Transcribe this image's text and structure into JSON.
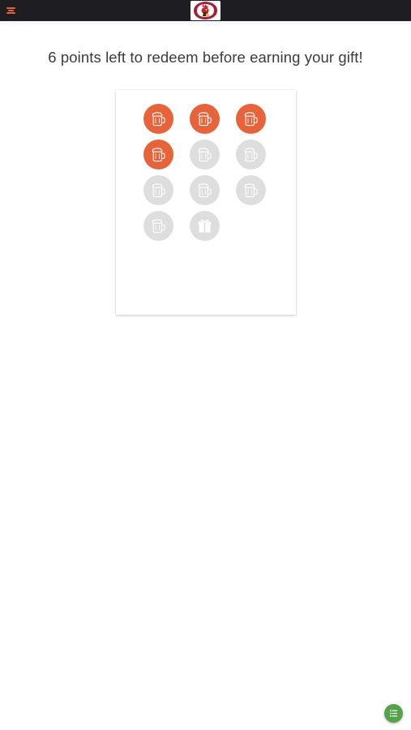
{
  "header": {
    "menu_icon": "hamburger-menu-icon",
    "logo_icon": "rooster-logo-icon",
    "menu_accent_color": "#e2643a"
  },
  "main": {
    "title": "6 points left to redeem before earning your gift!"
  },
  "punch_card": {
    "earned": 4,
    "total": 10,
    "stamp_icon": "coffee-mug-icon",
    "reward_icon": "gift-icon",
    "filled_color": "#e8633a",
    "empty_color": "#dedede",
    "stamps": [
      true,
      true,
      true,
      true,
      false,
      false,
      false,
      false,
      false,
      false
    ]
  },
  "fab": {
    "icon": "list-icon",
    "color": "#55a24b"
  }
}
